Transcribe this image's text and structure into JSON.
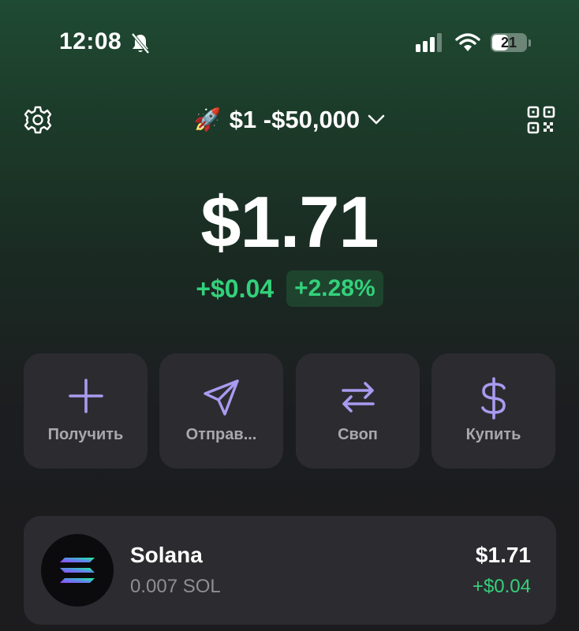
{
  "status_bar": {
    "time": "12:08",
    "battery": "21",
    "icons": [
      "bell-slash-icon",
      "cellular-signal-icon",
      "wifi-icon",
      "battery-icon"
    ]
  },
  "header": {
    "account_emoji": "🚀",
    "account_name": "$1 -$50,000",
    "icons": [
      "gear-icon",
      "chevron-down-icon",
      "qr-code-icon"
    ]
  },
  "balance": {
    "total": "$1.71",
    "change_abs": "+$0.04",
    "change_pct": "+2.28%"
  },
  "actions": [
    {
      "label": "Получить",
      "icon": "plus-icon"
    },
    {
      "label": "Отправ...",
      "icon": "send-icon"
    },
    {
      "label": "Своп",
      "icon": "swap-icon"
    },
    {
      "label": "Купить",
      "icon": "dollar-icon"
    }
  ],
  "tokens": [
    {
      "name": "Solana",
      "amount": "0.007 SOL",
      "value": "$1.71",
      "change": "+$0.04",
      "icon": "solana-logo-icon"
    }
  ],
  "colors": {
    "accent": "#a99bf0",
    "positive": "#33d17a",
    "card": "#2c2c30",
    "header_green": "#1f4a33"
  }
}
